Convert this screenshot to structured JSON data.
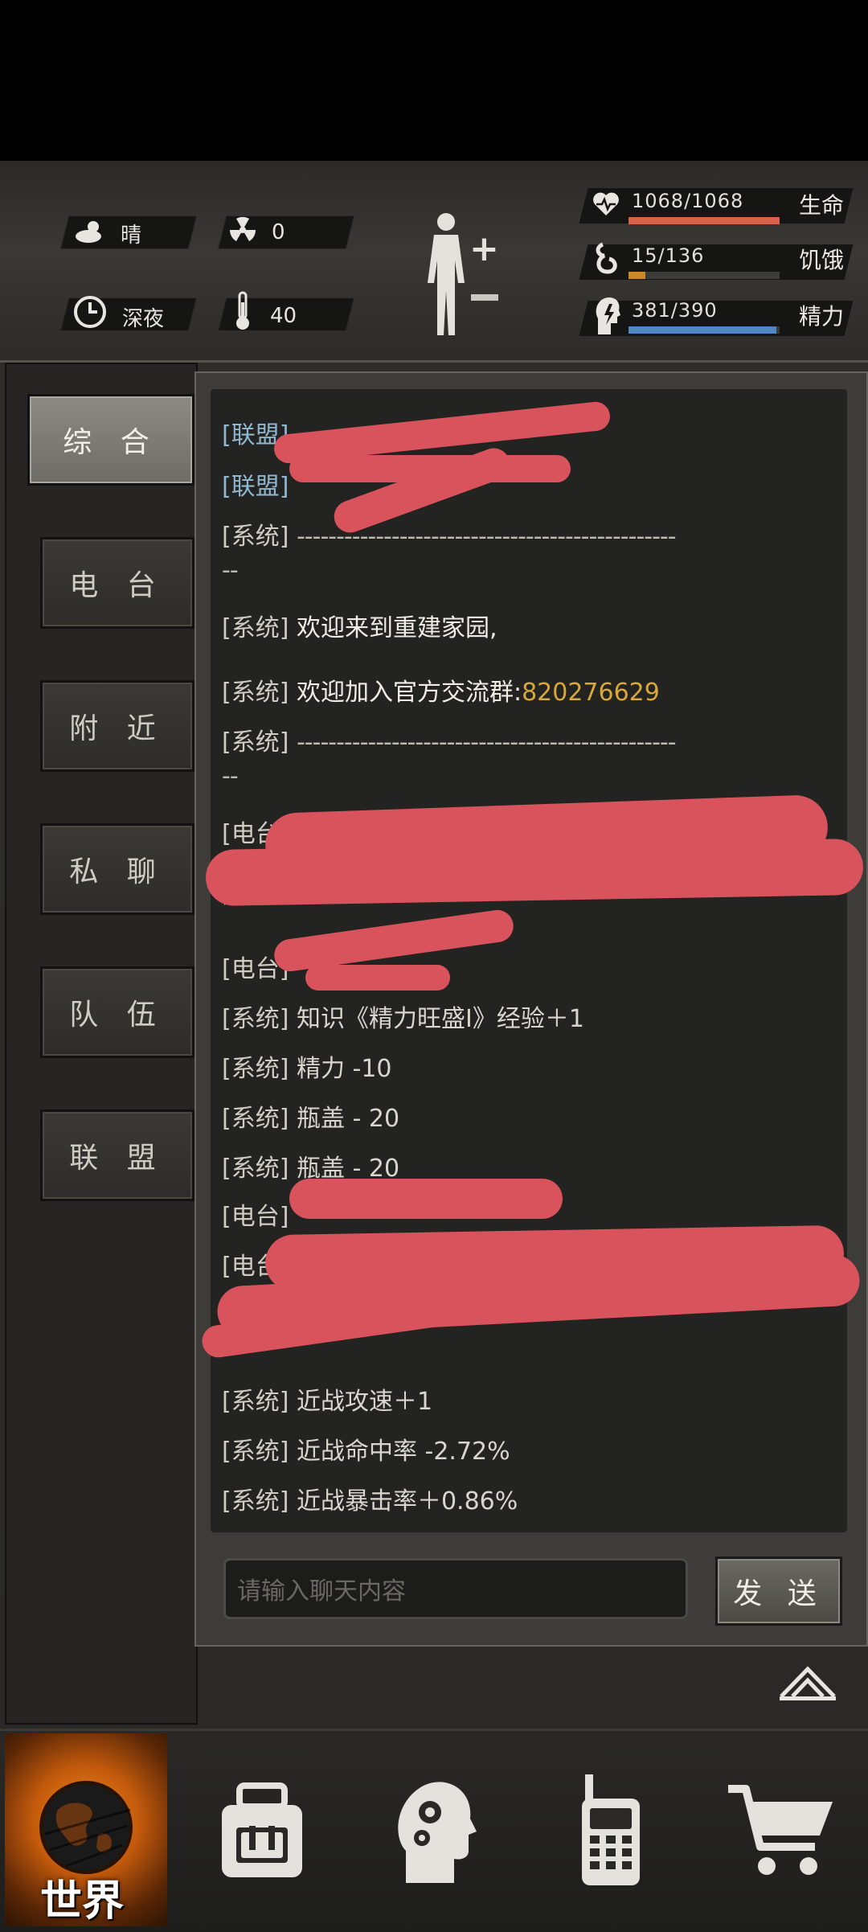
{
  "hud": {
    "weather_label": "晴",
    "radiation_value": "0",
    "time_label": "深夜",
    "temperature_value": "40",
    "stats": [
      {
        "label": "生命",
        "value_text": "1068/1068",
        "fraction": 1.0,
        "color": "#d9614a"
      },
      {
        "label": "饥饿",
        "value_text": "15/136",
        "fraction": 0.11,
        "color": "#c98a2a"
      },
      {
        "label": "精力",
        "value_text": "381/390",
        "fraction": 0.977,
        "color": "#4f86c3"
      }
    ]
  },
  "tabs": [
    "综 合",
    "电 台",
    "附 近",
    "私 聊",
    "队 伍",
    "联 盟"
  ],
  "chat": {
    "messages": [
      {
        "tag": "[联盟]",
        "text": "",
        "kind": "ally"
      },
      {
        "tag": "[联盟]",
        "text": "",
        "kind": "ally"
      },
      {
        "tag": "[系统]",
        "text": "------------------------------------------------",
        "kind": "dash"
      },
      {
        "tag": "",
        "text": "--",
        "kind": "dash-cont"
      },
      {
        "tag": "[系统]",
        "text": "欢迎来到重建家园,",
        "kind": "normal"
      },
      {
        "tag": "[系统]",
        "text": " 欢迎加入官方交流群:",
        "num": "820276629",
        "kind": "normal"
      },
      {
        "tag": "[系统]",
        "text": "------------------------------------------------",
        "kind": "dash"
      },
      {
        "tag": "",
        "text": "--",
        "kind": "dash-cont"
      },
      {
        "tag": "[电台]",
        "text": "",
        "kind": "normal"
      },
      {
        "tag": "",
        "text": "~",
        "kind": "cont"
      },
      {
        "tag": "[电台]",
        "text": "",
        "kind": "normal"
      },
      {
        "tag": "[系统]",
        "text": "知识《精力旺盛Ⅰ》经验＋1",
        "kind": "normal"
      },
      {
        "tag": "[系统]",
        "text": "精力 -10",
        "kind": "normal"
      },
      {
        "tag": "[系统]",
        "text": "瓶盖 - 20",
        "kind": "normal"
      },
      {
        "tag": "[系统]",
        "text": "瓶盖 - 20",
        "kind": "normal"
      },
      {
        "tag": "[电台]",
        "text": "",
        "kind": "normal"
      },
      {
        "tag": "[电台]",
        "text": "",
        "kind": "normal"
      },
      {
        "tag": "",
        "text": "惠)",
        "kind": "cont"
      },
      {
        "tag": "[系统]",
        "text": "近战攻速＋1",
        "kind": "normal"
      },
      {
        "tag": "[系统]",
        "text": "近战命中率 -2.72%",
        "kind": "normal"
      },
      {
        "tag": "[系统]",
        "text": "近战暴击率＋0.86%",
        "kind": "normal"
      }
    ],
    "input_placeholder": "请输入聊天内容",
    "send_label": "发 送"
  },
  "nav": {
    "world_label": "世界",
    "items": [
      "world-globe-icon",
      "backpack-icon",
      "skills-head-icon",
      "radio-walkie-icon",
      "shop-cart-icon"
    ]
  }
}
